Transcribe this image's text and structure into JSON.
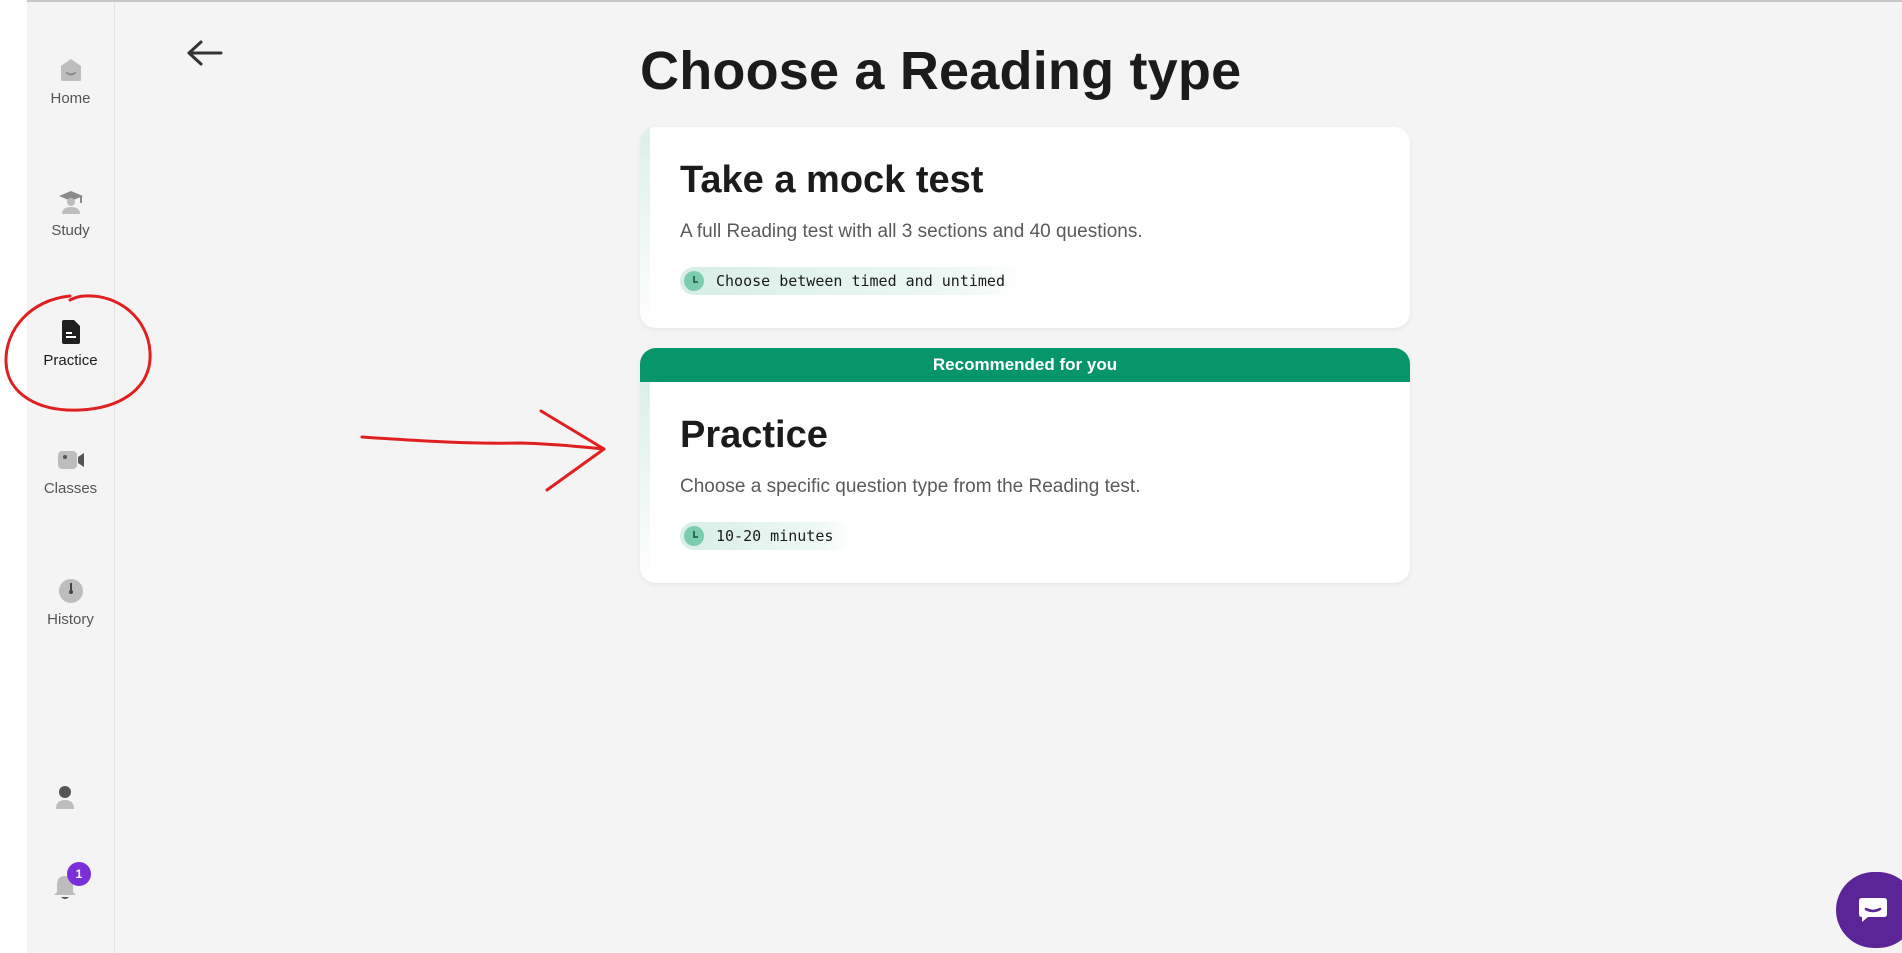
{
  "sidebar": {
    "items": [
      {
        "label": "Home",
        "icon": "home-icon"
      },
      {
        "label": "Study",
        "icon": "graduation-cap-icon"
      },
      {
        "label": "Practice",
        "icon": "document-icon"
      },
      {
        "label": "Classes",
        "icon": "video-camera-icon"
      },
      {
        "label": "History",
        "icon": "clock-icon"
      }
    ],
    "profile_icon": "user-icon",
    "notifications": {
      "icon": "bell-icon",
      "count": "1"
    }
  },
  "header": {
    "back_icon": "arrow-left-icon",
    "title": "Choose a Reading type"
  },
  "cards": [
    {
      "title": "Take a mock test",
      "description": "A full Reading test with all 3 sections and 40 questions.",
      "chip": "Choose between timed and untimed"
    },
    {
      "banner": "Recommended for you",
      "title": "Practice",
      "description": "Choose a specific question type from the Reading test.",
      "chip": "10-20 minutes"
    }
  ],
  "chat": {
    "icon": "chat-icon"
  },
  "colors": {
    "accent_green": "#07956a",
    "chip_green": "#7ccdb0",
    "badge_purple": "#7b2fd9",
    "chat_purple": "#5b2497",
    "annotation_red": "#e02020"
  }
}
